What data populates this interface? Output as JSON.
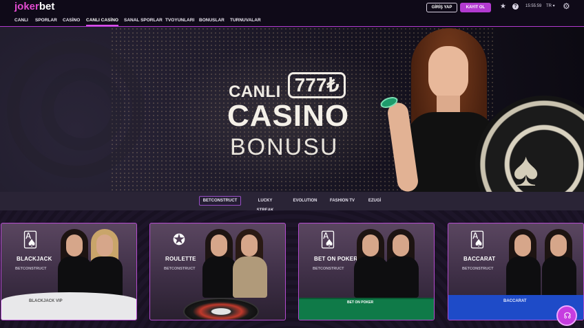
{
  "header": {
    "logo_part1": "joker",
    "logo_part2": "bet",
    "login_label": "GİRİŞ YAP",
    "register_label": "KAYIT OL",
    "clock": "15:55:59",
    "language": "TR ▾",
    "brand_color": "#b23ad0"
  },
  "nav": {
    "items": [
      {
        "label": "CANLI"
      },
      {
        "label": "SPORLAR"
      },
      {
        "label": "CASİNO"
      },
      {
        "label": "CANLI CASİNO"
      },
      {
        "label": "SANAL SPORLAR"
      },
      {
        "label": "TVOYUNLARI"
      },
      {
        "label": "BONUSLAR"
      },
      {
        "label": "TURNUVALAR"
      }
    ],
    "active_index": 3
  },
  "hero": {
    "line1": "CANLI",
    "amount": "777₺",
    "line2": "CASINO",
    "line3": "BONUSU"
  },
  "providers": {
    "items": [
      {
        "label": "BETCONSTRUCT"
      },
      {
        "label": "LUCKY STREAK"
      },
      {
        "label": "EVOLUTION"
      },
      {
        "label": "FASHION TV"
      },
      {
        "label": "EZUGİ"
      }
    ],
    "active_index": 0
  },
  "games": [
    {
      "name": "BLACKJACK",
      "provider": "BETCONSTRUCT",
      "icon": "playing-cards-icon",
      "table_text": "BLACKJACK VIP"
    },
    {
      "name": "ROULETTE",
      "provider": "BETCONSTRUCT",
      "icon": "roulette-chip-icon"
    },
    {
      "name": "BET ON POKER",
      "provider": "BETCONSTRUCT",
      "icon": "ace-card-icon",
      "table_text": "BET ON POKER"
    },
    {
      "name": "BACCARAT",
      "provider": "BETCONSTRUCT",
      "icon": "playing-cards-icon",
      "table_text": "BACCARAT"
    }
  ]
}
